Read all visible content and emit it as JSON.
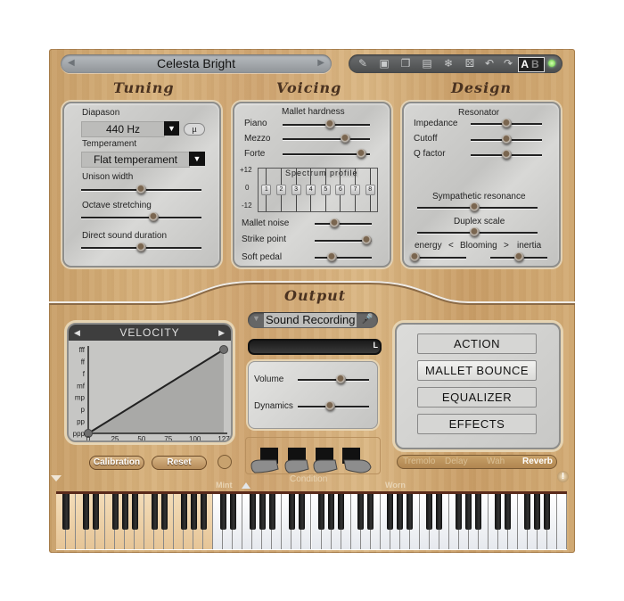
{
  "header": {
    "preset_name": "Celesta Bright",
    "prev_icon": "triangle-left",
    "next_icon": "triangle-right"
  },
  "toolbar": {
    "icons": [
      "edit-icon",
      "save-icon",
      "copy-icon",
      "paste-icon",
      "freeze-icon",
      "random-dice-icon",
      "undo-icon",
      "redo-icon"
    ],
    "ab_a": "A",
    "ab_b": "B",
    "status_led_color": "#5ec83a"
  },
  "sections": {
    "tuning": "Tuning",
    "voicing": "Voicing",
    "design": "Design",
    "output": "Output"
  },
  "tuning": {
    "diapason_label": "Diapason",
    "diapason_value": "440 Hz",
    "micro_button": "µ",
    "temperament_label": "Temperament",
    "temperament_value": "Flat temperament",
    "sliders": [
      {
        "label": "Unison width",
        "value": 0.5
      },
      {
        "label": "Octave stretching",
        "value": 0.6
      },
      {
        "label": "Direct sound duration",
        "value": 0.5
      }
    ]
  },
  "voicing": {
    "mallet_hardness_label": "Mallet hardness",
    "mallet_sliders": [
      {
        "label": "Piano",
        "value": 0.55
      },
      {
        "label": "Mezzo",
        "value": 0.72
      },
      {
        "label": "Forte",
        "value": 0.9
      }
    ],
    "spectrum": {
      "title": "Spectrum profile",
      "y_max": "+12",
      "y_mid": "0",
      "y_min": "-12",
      "bands": [
        "1",
        "2",
        "3",
        "4",
        "5",
        "6",
        "7",
        "8"
      ],
      "values": [
        0,
        0,
        0,
        0,
        0,
        0,
        0,
        0
      ]
    },
    "sliders": [
      {
        "label": "Mallet noise",
        "value": 0.35
      },
      {
        "label": "Strike point",
        "value": 0.92
      },
      {
        "label": "Soft pedal",
        "value": 0.3
      }
    ]
  },
  "design": {
    "resonator_label": "Resonator",
    "resonator_sliders": [
      {
        "label": "Impedance",
        "value": 0.5
      },
      {
        "label": "Cutoff",
        "value": 0.5
      },
      {
        "label": "Q factor",
        "value": 0.5
      }
    ],
    "sympathetic_label": "Sympathetic resonance",
    "sympathetic_value": 0.48,
    "duplex_label": "Duplex scale",
    "duplex_value": 0.48,
    "blooming_energy_label": "energy",
    "blooming_label": "Blooming",
    "blooming_inertia_label": "inertia",
    "blooming_left_arrow": "<",
    "blooming_right_arrow": ">",
    "blooming_energy_value": 0.0,
    "blooming_inertia_value": 0.5
  },
  "velocity": {
    "title": "VELOCITY",
    "y_labels": [
      "fff",
      "ff",
      "f",
      "mf",
      "mp",
      "p",
      "pp",
      "ppp"
    ],
    "x_labels": [
      "0",
      "25",
      "50",
      "75",
      "100",
      "127"
    ],
    "curve_points": [
      [
        0,
        0
      ],
      [
        127,
        127
      ]
    ],
    "calibration_button": "Calibration",
    "reset_button": "Reset"
  },
  "output": {
    "sound_recording": "Sound Recording",
    "meter_label": "L",
    "sliders": [
      {
        "label": "Volume",
        "value": 0.6
      },
      {
        "label": "Dynamics",
        "value": 0.45
      }
    ],
    "condition_label": "Condition",
    "condition_min": "Mint",
    "condition_max": "Worn"
  },
  "menu": {
    "buttons": [
      "ACTION",
      "MALLET BOUNCE",
      "EQUALIZER",
      "EFFECTS"
    ],
    "active": "MALLET BOUNCE"
  },
  "fx": {
    "items": [
      "Tremolo",
      "Delay",
      "Wah",
      "Reverb"
    ],
    "active": "Reverb"
  },
  "keyboard": {
    "white_key_count": 52,
    "highlight_range_white_keys": 16,
    "info_icon": "!"
  }
}
